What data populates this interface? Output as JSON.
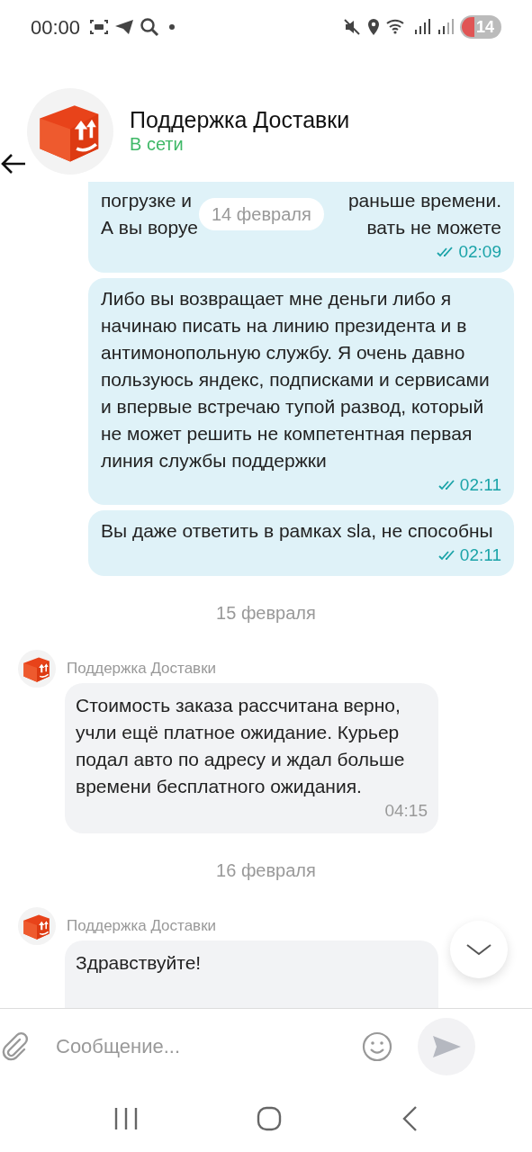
{
  "status_bar": {
    "time": "00:00",
    "battery": "14"
  },
  "header": {
    "title": "Поддержка Доставки",
    "status": "В сети"
  },
  "sticky_date": "14 февраля",
  "messages": [
    {
      "kind": "outgoing",
      "partial_lines": [
        {
          "left": "погрузке и",
          "right": "раньше времени."
        },
        {
          "left": "А вы воруе",
          "right": "вать не можете"
        }
      ],
      "time": "02:09",
      "read": true
    },
    {
      "kind": "outgoing",
      "text": "Либо вы возвращает мне деньги либо я начинаю писать на линию президента и в антимонопольную службу. Я очень давно пользуюсь яндекс, подписками и сервисами и впервые встречаю тупой развод, который не может решить не компетентная первая линия службы поддержки",
      "time": "02:11",
      "read": true
    },
    {
      "kind": "outgoing",
      "text": "Вы даже ответить в рамках sla, не способны",
      "time": "02:11",
      "read": true
    },
    {
      "kind": "date",
      "text": "15 февраля"
    },
    {
      "kind": "incoming",
      "sender": "Поддержка Доставки",
      "text": "Стоимость заказа рассчитана верно, учли ещё платное ожидание. Курьер подал авто по адресу и ждал больше времени бесплатного ожидания.",
      "time": "04:15"
    },
    {
      "kind": "date",
      "text": "16 февраля"
    },
    {
      "kind": "incoming",
      "sender": "Поддержка Доставки",
      "text": "Здравствуйте!"
    }
  ],
  "composer": {
    "placeholder": "Сообщение..."
  }
}
